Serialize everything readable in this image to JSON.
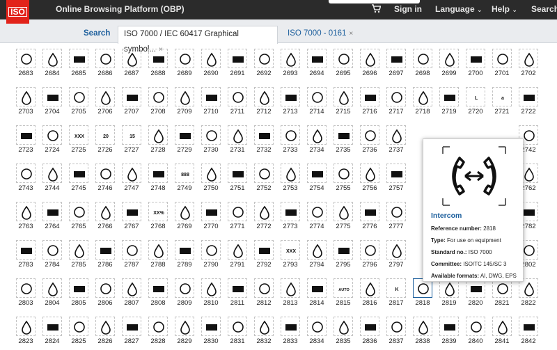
{
  "header": {
    "logo_text": "ISO",
    "app_title": "Online Browsing Platform (OBP)",
    "cart_icon": "cart-icon",
    "nav": [
      {
        "label": "Sign in"
      },
      {
        "label": "Language",
        "icon": "chevron-down-icon"
      },
      {
        "label": "Help",
        "icon": "chevron-down-icon"
      },
      {
        "label": "Search"
      }
    ]
  },
  "tabs": {
    "search_label": "Search",
    "items": [
      {
        "label": "ISO 7000 / IEC 60417 Graphical symbol..."
      },
      {
        "label": "ISO 7000 - 0161"
      }
    ],
    "close_glyph": "×"
  },
  "grid": {
    "rows": [
      [
        "2683",
        "2684",
        "2685",
        "2686",
        "2687",
        "2688",
        "2689",
        "2690",
        "2691",
        "2692",
        "2693",
        "2694",
        "2695",
        "2696",
        "2697",
        "2698",
        "2699",
        "2700",
        "2701",
        "2702"
      ],
      [
        "2703",
        "2704",
        "2705",
        "2706",
        "2707",
        "2708",
        "2709",
        "2710",
        "2711",
        "2712",
        "2713",
        "2714",
        "2715",
        "2716",
        "2717",
        "2718",
        "2719",
        "2720",
        "2721",
        "2722"
      ],
      [
        "2723",
        "2724",
        "2725",
        "2726",
        "2727",
        "2728",
        "2729",
        "2730",
        "2731",
        "2732",
        "2733",
        "2734",
        "2735",
        "2736",
        "2737",
        "",
        "",
        "",
        "",
        "2742"
      ],
      [
        "2743",
        "2744",
        "2745",
        "2746",
        "2747",
        "2748",
        "2749",
        "2750",
        "2751",
        "2752",
        "2753",
        "2754",
        "2755",
        "2756",
        "2757",
        "",
        "",
        "",
        "",
        "2762"
      ],
      [
        "2763",
        "2764",
        "2765",
        "2766",
        "2767",
        "2768",
        "2769",
        "2770",
        "2771",
        "2772",
        "2773",
        "2774",
        "2775",
        "2776",
        "2777",
        "",
        "",
        "",
        "",
        "2782"
      ],
      [
        "2783",
        "2784",
        "2785",
        "2786",
        "2787",
        "2788",
        "2789",
        "2790",
        "2791",
        "2792",
        "2793",
        "2794",
        "2795",
        "2796",
        "2797",
        "",
        "",
        "",
        "",
        "2802"
      ],
      [
        "2803",
        "2804",
        "2805",
        "2806",
        "2807",
        "2808",
        "2809",
        "2810",
        "2811",
        "2812",
        "2813",
        "2814",
        "2815",
        "2816",
        "2817",
        "2818",
        "2819",
        "2820",
        "2821",
        "2822"
      ],
      [
        "2823",
        "2824",
        "2825",
        "2826",
        "2827",
        "2828",
        "2829",
        "2830",
        "2831",
        "2832",
        "2833",
        "2834",
        "2835",
        "2836",
        "2837",
        "2838",
        "2839",
        "2840",
        "2841",
        "2842"
      ]
    ],
    "inline_text": {
      "2725": "XXX",
      "2726": "20",
      "2726b": "ml",
      "2727": "15",
      "2749": "888",
      "2768": "XX%",
      "2793": "XXX",
      "2815": "AUTO",
      "2721": "a",
      "2720": "L",
      "2817": "K"
    },
    "selected": "2818"
  },
  "tooltip": {
    "title": "Intercom",
    "reference_label": "Reference number:",
    "reference_value": "2818",
    "type_label": "Type:",
    "type_value": "For use on equipment",
    "standard_label": "Standard no.:",
    "standard_value": "ISO 7000",
    "committee_label": "Committee:",
    "committee_value": "ISO/TC 145/SC 3",
    "formats_label": "Available formats:",
    "formats_value": "AI, DWG, EPS"
  },
  "colors": {
    "header_bg": "#2b2b2b",
    "brand_red": "#e2231a",
    "link_blue": "#1b5e9c"
  }
}
